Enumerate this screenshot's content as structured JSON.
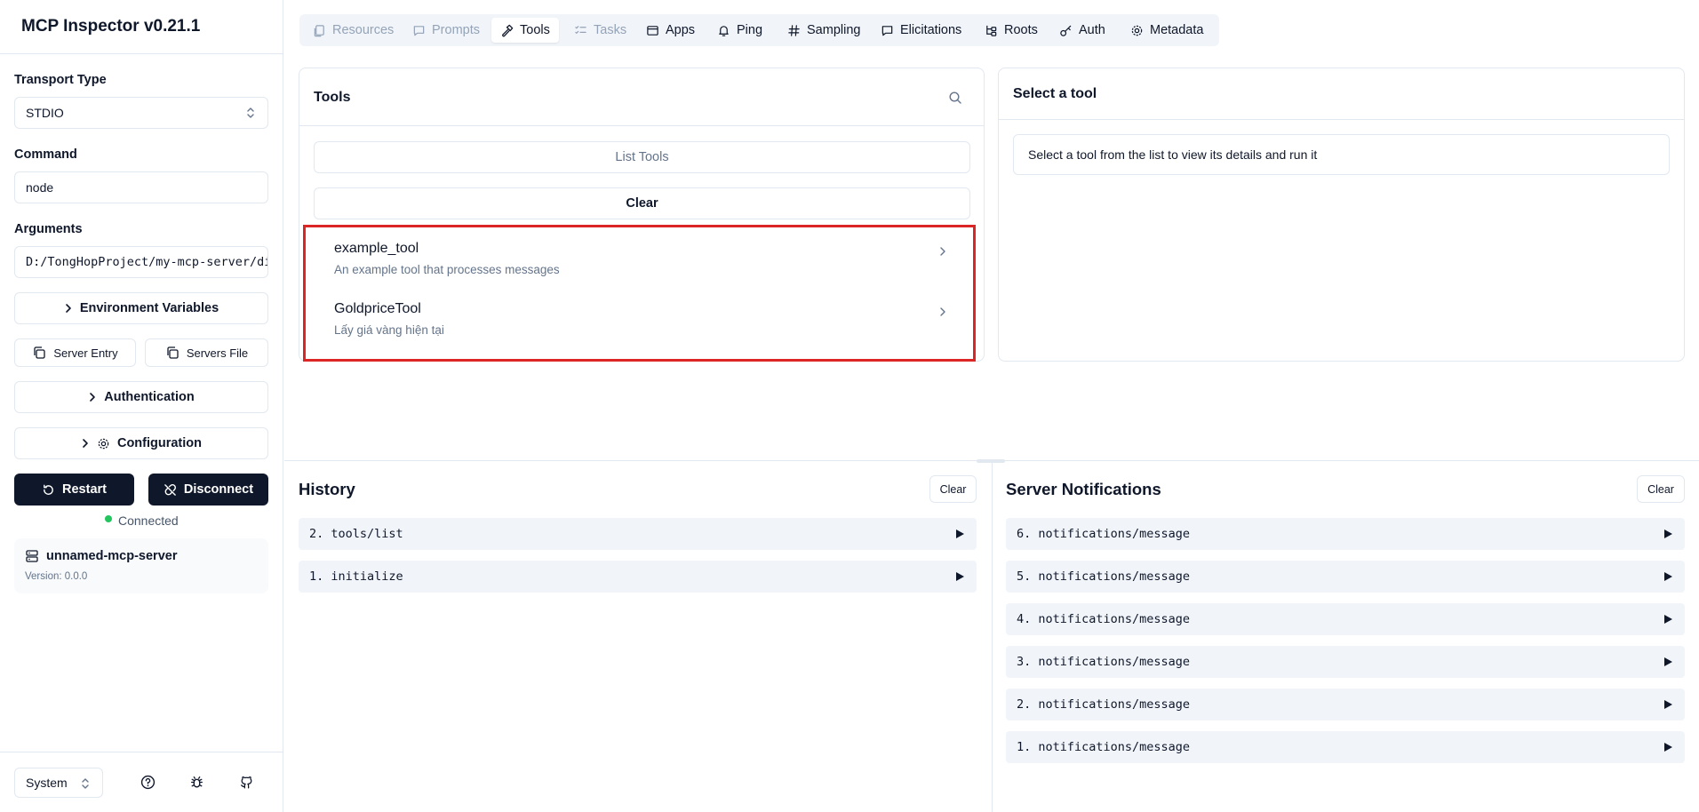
{
  "app": {
    "title": "MCP Inspector v0.21.1"
  },
  "sidebar": {
    "transport_label": "Transport Type",
    "transport_value": "STDIO",
    "command_label": "Command",
    "command_value": "node",
    "arguments_label": "Arguments",
    "arguments_value": "D:/TongHopProject/my-mcp-server/dist/index.js",
    "env_button": "Environment Variables",
    "server_entry_button": "Server Entry",
    "servers_file_button": "Servers File",
    "auth_button": "Authentication",
    "config_button": "Configuration",
    "restart_button": "Restart",
    "disconnect_button": "Disconnect",
    "status": "Connected",
    "status_color": "#22c55e",
    "server_name": "unnamed-mcp-server",
    "server_version": "Version: 0.0.0",
    "theme_value": "System"
  },
  "tabs": [
    {
      "label": "Resources",
      "icon": "files-icon",
      "disabled": true
    },
    {
      "label": "Prompts",
      "icon": "message-icon",
      "disabled": true
    },
    {
      "label": "Tools",
      "icon": "hammer-icon",
      "active": true
    },
    {
      "label": "Tasks",
      "icon": "list-checks-icon",
      "disabled": true
    },
    {
      "label": "Apps",
      "icon": "app-window-icon"
    },
    {
      "label": "Ping",
      "icon": "bell-icon"
    },
    {
      "label": "Sampling",
      "icon": "hash-icon"
    },
    {
      "label": "Elicitations",
      "icon": "message-square-icon"
    },
    {
      "label": "Roots",
      "icon": "folder-tree-icon"
    },
    {
      "label": "Auth",
      "icon": "key-icon"
    },
    {
      "label": "Metadata",
      "icon": "settings-icon"
    }
  ],
  "tools_panel": {
    "title": "Tools",
    "list_button": "List Tools",
    "clear_button": "Clear",
    "items": [
      {
        "name": "example_tool",
        "description": "An example tool that processes messages"
      },
      {
        "name": "GoldpriceTool",
        "description": "Lấy giá vàng hiện tại"
      }
    ],
    "highlight_color": "#dc2626"
  },
  "detail_panel": {
    "title": "Select a tool",
    "message": "Select a tool from the list to view its details and run it"
  },
  "history": {
    "title": "History",
    "clear_button": "Clear",
    "items": [
      "2. tools/list",
      "1. initialize"
    ]
  },
  "notifications": {
    "title": "Server Notifications",
    "clear_button": "Clear",
    "items": [
      "6. notifications/message",
      "5. notifications/message",
      "4. notifications/message",
      "3. notifications/message",
      "2. notifications/message",
      "1. notifications/message"
    ]
  }
}
